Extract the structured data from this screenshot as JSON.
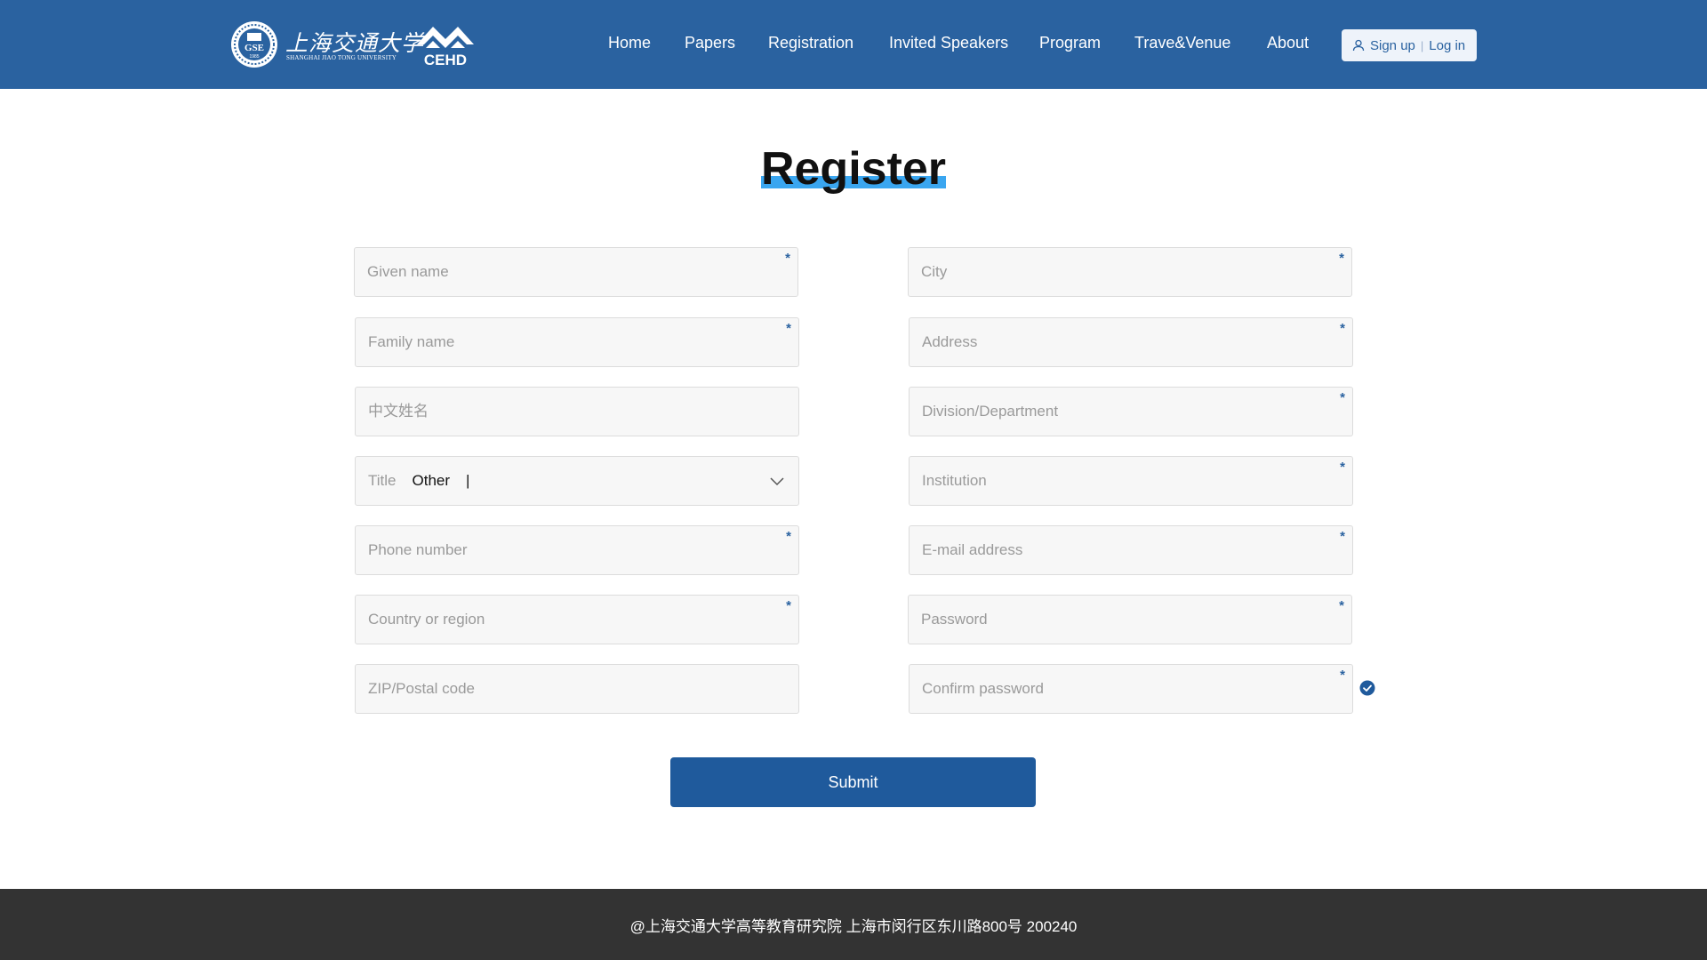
{
  "header": {
    "logos": {
      "seal_text": "GSE",
      "seal_year": "1985",
      "university_cn": "上海交通大学",
      "university_en": "SHANGHAI JIAO TONG UNIVERSITY",
      "cehd_text": "CEHD"
    },
    "nav": [
      {
        "label": "Home"
      },
      {
        "label": "Papers"
      },
      {
        "label": "Registration"
      },
      {
        "label": "Invited Speakers"
      },
      {
        "label": "Program"
      },
      {
        "label": "Trave&Venue"
      },
      {
        "label": "About"
      }
    ],
    "auth": {
      "signup": "Sign up",
      "separator": "|",
      "login": "Log in",
      "icon": "user-icon"
    }
  },
  "page": {
    "title": "Register"
  },
  "form": {
    "left": {
      "given_name": {
        "placeholder": "Given name",
        "required": "*"
      },
      "family_name": {
        "placeholder": "Family name",
        "required": "*"
      },
      "chinese_name": {
        "placeholder": "中文姓名"
      },
      "title": {
        "label": "Title",
        "value": "Other",
        "cursor": "|",
        "icon": "chevron-down-icon"
      },
      "phone": {
        "placeholder": "Phone number",
        "required": "*"
      },
      "country": {
        "placeholder": "Country or region",
        "required": "*"
      },
      "zip": {
        "placeholder": "ZIP/Postal code"
      }
    },
    "right": {
      "city": {
        "placeholder": "City",
        "required": "*"
      },
      "address": {
        "placeholder": "Address",
        "required": "*"
      },
      "division": {
        "placeholder": "Division/Department",
        "required": "*"
      },
      "institution": {
        "placeholder": "Institution",
        "required": "*"
      },
      "email": {
        "placeholder": "E-mail address",
        "required": "*"
      },
      "password": {
        "placeholder": "Password",
        "required": "*"
      },
      "confirm_password": {
        "placeholder": "Confirm password",
        "required": "*",
        "status_icon": "check-circle-icon"
      }
    },
    "submit_label": "Submit"
  },
  "footer": {
    "text": "@上海交通大学高等教育研究院   上海市闵行区东川路800号   200240"
  },
  "colors": {
    "header_bg": "#2a62a0",
    "accent": "#3aa6f0",
    "button": "#1f5a9c",
    "footer_bg": "#333333"
  }
}
